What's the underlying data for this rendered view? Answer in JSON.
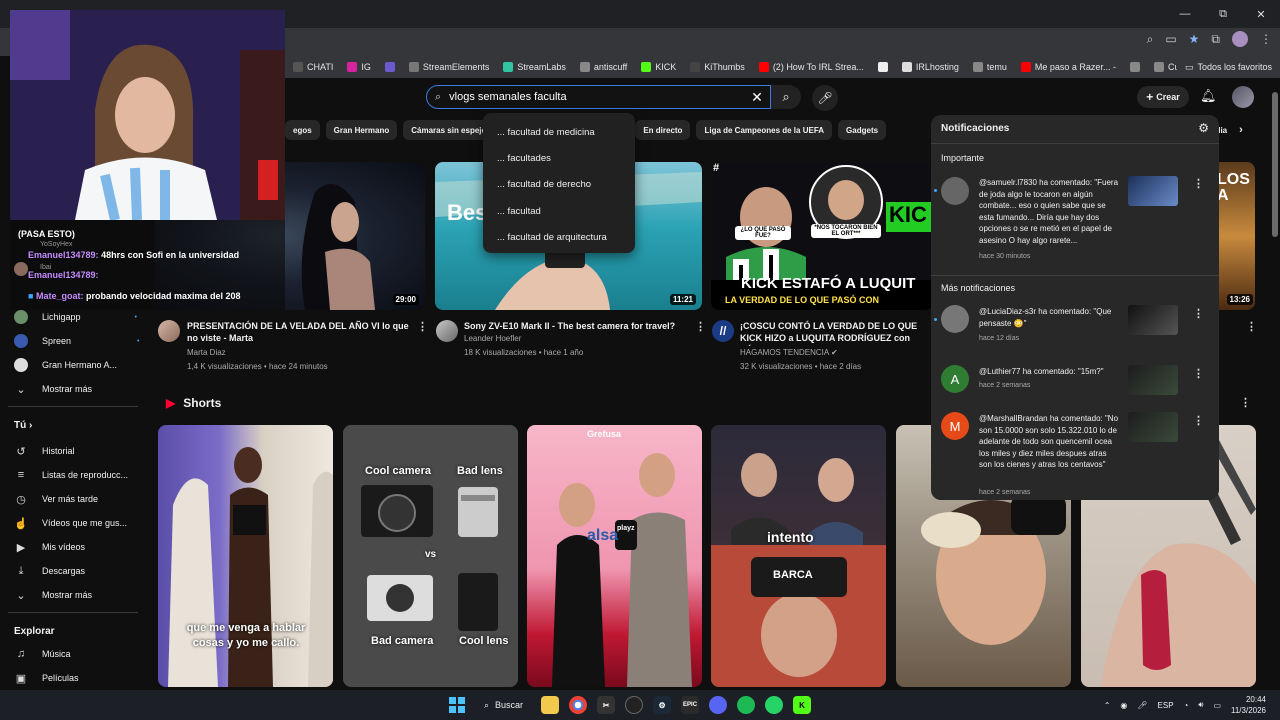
{
  "browser": {
    "window_controls": [
      "—",
      "⧉",
      "✕"
    ],
    "bookmarks": [
      {
        "label": "CHATI",
        "color": "#555"
      },
      {
        "label": "IG",
        "color": "#d6249f"
      },
      {
        "label": "",
        "color": "#6a5acd"
      },
      {
        "label": "StreamElements",
        "color": "#777"
      },
      {
        "label": "StreamLabs",
        "color": "#31c3a2"
      },
      {
        "label": "antiscuff",
        "color": "#888"
      },
      {
        "label": "KICK",
        "color": "#53fc18"
      },
      {
        "label": "KiThumbs",
        "color": "#444"
      },
      {
        "label": "(2) How To IRL Strea...",
        "color": "#ff0000"
      },
      {
        "label": "",
        "color": "#eee"
      },
      {
        "label": "IRLhosting",
        "color": "#ddd"
      },
      {
        "label": "temu",
        "color": "#888"
      },
      {
        "label": "Me paso a Razer... -",
        "color": "#ff0000"
      },
      {
        "label": "",
        "color": "#888"
      },
      {
        "label": "Cutout.Pro - Edición...",
        "color": "#888"
      }
    ],
    "all_bookmarks": "Todos los favoritos"
  },
  "header": {
    "search_value": "vlogs semanales faculta",
    "create_label": "Crear"
  },
  "suggestions": [
    "... facultad de medicina",
    "... facultades",
    "... facultad de derecho",
    "... facultad",
    "... facultad de arquitectura"
  ],
  "chips": [
    "egos",
    "Gran Hermano",
    "Cámaras sin espejo de",
    "",
    "",
    "Maletas",
    "En directo",
    "Liga de Campeones de la UEFA",
    "Gadgets"
  ],
  "chat": [
    {
      "user": "",
      "text": "(PASA ESTO)",
      "color": "#ffffff"
    },
    {
      "user": "YoSoyHex",
      "text": "",
      "color": "#aaaaaa"
    },
    {
      "user": "Emanuel134789:",
      "text": "48hrs con Sofi en la universidad",
      "color": "#c58cff"
    },
    {
      "user": "Ibai",
      "text": "",
      "color": "#aaaaaa"
    },
    {
      "user": "Emanuel134789:",
      "text": "",
      "color": "#c58cff"
    },
    {
      "user": "Mate_goat:",
      "text": "probando velocidad maxima del 208",
      "color": "#c58cff"
    }
  ],
  "sidebar": {
    "subs": [
      {
        "label": "Lichigapp",
        "color": "#6b8e6b"
      },
      {
        "label": "Spreen",
        "color": "#3a5ab0"
      },
      {
        "label": "Gran Hermano A...",
        "color": "#ddd"
      }
    ],
    "show_more_1": "Mostrar más",
    "you_heading": "Tú",
    "you_items": [
      {
        "label": "Historial",
        "icon": "history-icon",
        "glyph": "↺"
      },
      {
        "label": "Listas de reproducc...",
        "icon": "playlist-icon",
        "glyph": "≡"
      },
      {
        "label": "Ver más tarde",
        "icon": "clock-icon",
        "glyph": "◷"
      },
      {
        "label": "Vídeos que me gus...",
        "icon": "thumb-up-icon",
        "glyph": "☝"
      },
      {
        "label": "Mis vídeos",
        "icon": "video-icon",
        "glyph": "▶"
      },
      {
        "label": "Descargas",
        "icon": "download-icon",
        "glyph": "⤓"
      }
    ],
    "show_more_2": "Mostrar más",
    "explore_heading": "Explorar",
    "explore_items": [
      {
        "label": "Música",
        "icon": "music-icon",
        "glyph": "♫"
      },
      {
        "label": "Películas",
        "icon": "film-icon",
        "glyph": "▣"
      }
    ]
  },
  "videos": [
    {
      "title": "PRESENTACIÓN DE LA VELADA DEL AÑO VI lo que no viste - Marta",
      "channel": "Marta Diaz",
      "meta": "1,4 K visualizaciones • hace 24 minutos",
      "duration": "29:00"
    },
    {
      "title": "Sony ZV-E10 Mark II - The best camera for travel?",
      "channel": "Leander Hoefler",
      "meta": "18 K visualizaciones • hace 1 año",
      "duration": "11:21",
      "thumb_text": "Bes          era?"
    },
    {
      "title": "¡COSCU CONTÓ LA VERDAD DE LO QUE KICK HIZO a LUQUITA RODRÍGUEZ con PÁRENSE L",
      "channel": "HAGAMOS TENDENCIA",
      "meta": "32 K visualizaciones • hace 2 días",
      "thumb_headline": "KICK ESTAFÓ A LUQUIT",
      "thumb_sub": "LA VERDAD DE LO QUE PASÓ CON",
      "bubble_1": "¿LO QUE PASÓ FUE?",
      "bubble_2": "*NOS TOCARON BIEN EL ORT***",
      "kick_text": "KIC"
    },
    {
      "duration": "13:26",
      "thumb_text": "LOS A"
    }
  ],
  "shorts": {
    "heading": "Shorts",
    "items": [
      {
        "caption": "que me venga a hablar cosas y yo me callo."
      },
      {
        "top_left": "Cool camera",
        "top_right": "Bad lens",
        "middle": "vs",
        "bottom_left": "Bad camera",
        "bottom_right": "Cool lens"
      },
      {
        "brand": "alsa",
        "mic_label": "playz",
        "logo": "Grefusa"
      },
      {
        "caption": "intento",
        "cap_label": "BARCA"
      },
      {},
      {}
    ]
  },
  "notifications": {
    "title": "Notificaciones",
    "important_label": "Importante",
    "more_label": "Más notificaciones",
    "items": [
      {
        "avatar_letter": "",
        "avatar_color": "#666",
        "text": "@samuelr.l7830 ha comentado: \"Fuera de joda algo le tocaron en algún combate... eso o quien sabe que se esta fumando... Diría que hay dos opciones o se re metió en el papel de asesino O hay algo rarete...",
        "time": "hace 30 minutos"
      },
      {
        "avatar_letter": "",
        "avatar_color": "#777",
        "text": "@LuciaDiaz-s3r ha comentado: \"Que pensaste 😳\"",
        "time": "hace 12 días"
      },
      {
        "avatar_letter": "A",
        "avatar_color": "#2e7d32",
        "text": "@Luthier77 ha comentado: \"15m?\"",
        "time": "hace 2 semanas"
      },
      {
        "avatar_letter": "M",
        "avatar_color": "#e64a19",
        "text": "@MarshallBrandan ha comentado: \"No son 15.0000 son solo 15.322.010 lo de adelante de todo son quencemil ocea los miles y diez miles despues atras son los cienes y atras los centavos\"",
        "time": "hace 2 semanas"
      }
    ]
  },
  "taskbar": {
    "search_label": "Buscar",
    "lang": "ESP",
    "time": "20:44",
    "date": "11/3/2026"
  }
}
